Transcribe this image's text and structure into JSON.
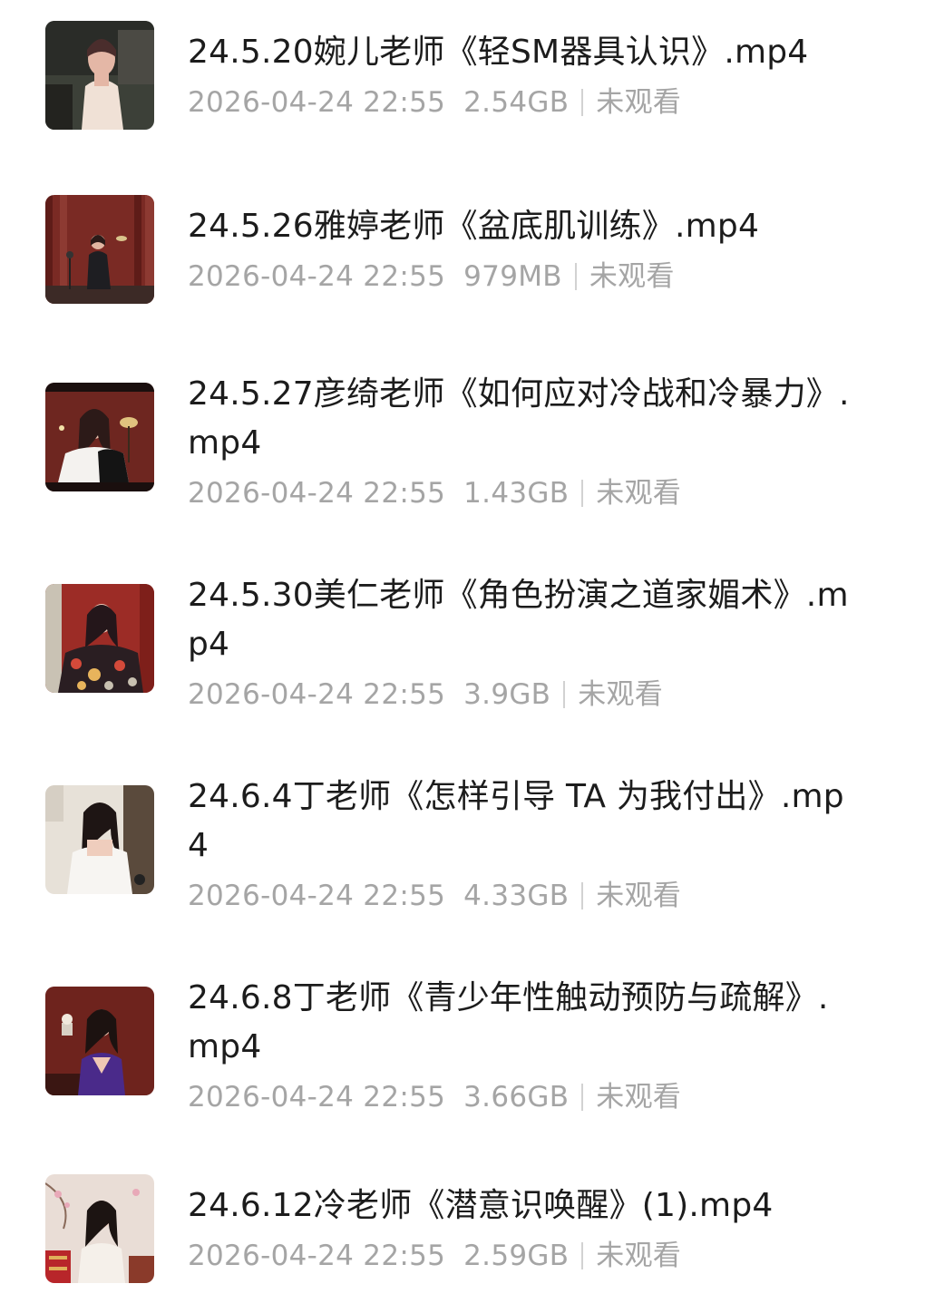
{
  "files": [
    {
      "name": "24.5.20婉儿老师《轻SM器具认识》.mp4",
      "date": "2026-04-24 22:55",
      "size": "2.54GB",
      "status": "未观看",
      "thumbnail_icon": "video-thumbnail"
    },
    {
      "name": "24.5.26雅婷老师《盆底肌训练》.mp4",
      "date": "2026-04-24 22:55",
      "size": "979MB",
      "status": "未观看",
      "thumbnail_icon": "video-thumbnail"
    },
    {
      "name": "24.5.27彦绮老师《如何应对冷战和冷暴力》.mp4",
      "date": "2026-04-24 22:55",
      "size": "1.43GB",
      "status": "未观看",
      "thumbnail_icon": "video-thumbnail"
    },
    {
      "name": "24.5.30美仁老师《角色扮演之道家媚术》.mp4",
      "date": "2026-04-24 22:55",
      "size": "3.9GB",
      "status": "未观看",
      "thumbnail_icon": "video-thumbnail"
    },
    {
      "name": "24.6.4丁老师《怎样引导 TA 为我付出》.mp4",
      "date": "2026-04-24 22:55",
      "size": "4.33GB",
      "status": "未观看",
      "thumbnail_icon": "video-thumbnail"
    },
    {
      "name": "24.6.8丁老师《青少年性触动预防与疏解》.mp4",
      "date": "2026-04-24 22:55",
      "size": "3.66GB",
      "status": "未观看",
      "thumbnail_icon": "video-thumbnail"
    },
    {
      "name": "24.6.12冷老师《潜意识唤醒》(1).mp4",
      "date": "2026-04-24 22:55",
      "size": "2.59GB",
      "status": "未观看",
      "thumbnail_icon": "video-thumbnail"
    }
  ],
  "colors": {
    "title_text": "#1c1c1c",
    "meta_text": "#a5a5a5",
    "divider": "#d2d2d2",
    "background": "#ffffff"
  }
}
